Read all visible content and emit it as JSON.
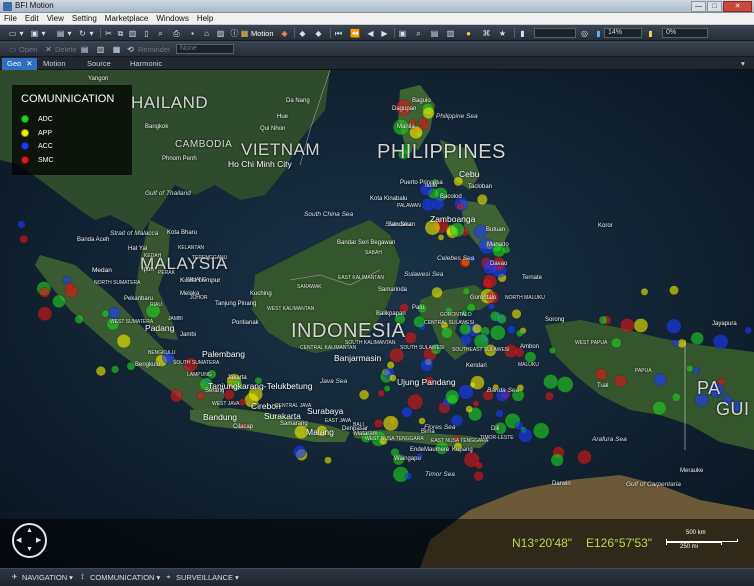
{
  "window": {
    "title": "BFI Motion",
    "controls": [
      "—",
      "□",
      "✕"
    ]
  },
  "menu": [
    "File",
    "Edit",
    "View",
    "Setting",
    "Marketplace",
    "Windows",
    "Help"
  ],
  "toolbar": {
    "motion_label": "Motion",
    "zoom_value": "14%",
    "progress_value": "0%"
  },
  "toolbar2": {
    "open_label": "Open",
    "delete_label": "Delete",
    "reminder_label": "Reminder",
    "reminder_value": "None"
  },
  "tabs": [
    {
      "label": "Geo",
      "active": true
    },
    {
      "label": "Motion",
      "active": false
    },
    {
      "label": "Source",
      "active": false
    },
    {
      "label": "Harmonic",
      "active": false
    }
  ],
  "legend": {
    "title": "COMUNNICATION",
    "items": [
      {
        "label": "ADC",
        "color": "#22d422"
      },
      {
        "label": "APP",
        "color": "#f5f000"
      },
      {
        "label": "ACC",
        "color": "#1a3cff"
      },
      {
        "label": "SMC",
        "color": "#e01818"
      }
    ]
  },
  "map_labels": {
    "countries": [
      "HAILAND",
      "CAMBODIA",
      "VIETNAM",
      "PHILIPPINES",
      "MALAYSIA",
      "INDONESIA",
      "PA",
      "GUI"
    ],
    "seas": [
      "South China Sea",
      "Sulu Sea",
      "Celebes Sea",
      "Sulawesi Sea",
      "Philippine Sea",
      "Java Sea",
      "Banda Sea",
      "Arafura Sea",
      "Timor Sea",
      "Gulf of Thailand",
      "Strait of Malacca",
      "Flores Sea",
      "Gulf of Carpentaria"
    ],
    "big_cities": [
      "Ho Chi Minh City",
      "Kuala Lumpur",
      "Palembang",
      "Tanjungkarang-Telukbetung",
      "Bandung",
      "Cirebon",
      "Surakarta",
      "Surabaya",
      "Malang",
      "Banjarmasin",
      "Ujung Pandang",
      "Cebu",
      "Zamboanga",
      "Medan",
      "Padang"
    ],
    "small_cities": [
      "Yangon",
      "Bangkok",
      "Phnom Penh",
      "Qui Nhon",
      "Manila",
      "Kuching",
      "Pontianak",
      "Samarinda",
      "Balikpapan",
      "Bengkulu",
      "Jakarta",
      "Serang",
      "Cilacap",
      "Bima",
      "Kupang",
      "Dili",
      "Kota Bharu",
      "Banda Aceh",
      "Davao",
      "Kendari",
      "Jayapura",
      "Darwin",
      "Kota Kinabalu",
      "Bandar Seri Begawan",
      "Koror",
      "Ambon",
      "Sorong",
      "Ternate",
      "Manado",
      "Tual",
      "Merauke",
      "Da Nang",
      "Hue",
      "Hat Yai",
      "Ipoh",
      "Melaka",
      "Tanjung Pinang",
      "Jambi",
      "Pekanbaru",
      "Samarang",
      "Mataram",
      "Denpasar",
      "Maumere",
      "Ende",
      "Waingapu",
      "Palu",
      "Gorontalo",
      "Sandakan",
      "Puerto Princesa",
      "Iloilo",
      "Bacolod",
      "Tacloban",
      "Butuan",
      "Baguio",
      "Dagupan"
    ],
    "regions": [
      "NORTH SUMATERA",
      "WEST SUMATERA",
      "SOUTH SUMATERA",
      "WEST KALIMANTAN",
      "CENTRAL KALIMANTAN",
      "EAST KALIMANTAN",
      "SOUTH KALIMANTAN",
      "SARAWAK",
      "SABAH",
      "PAPUA",
      "WEST PAPUA",
      "MALUKU",
      "NORTH MALUKU",
      "GORONTALO",
      "CENTRAL SULAWESI",
      "SOUTH SULAWESI",
      "SOUTHEAST SULAWESI",
      "EAST NUSA TENGGARA",
      "WEST NUSA TENGGARA",
      "WEST JAVA",
      "CENTRAL JAVA",
      "EAST JAVA",
      "BALI",
      "TIMOR-LESTE",
      "LAMPUNG",
      "BENGKULU",
      "JAMBI",
      "RIAU",
      "JOHOR",
      "PAHANG",
      "KEDAH",
      "PERAK",
      "KELANTAN",
      "TERENGGANU",
      "PALAWAN"
    ]
  },
  "coordinates": {
    "lat": "N13°20'48\"",
    "lon": "E126°57'53\""
  },
  "scale": {
    "km": "500 km",
    "mi": "250 mi"
  },
  "status": [
    {
      "label": "NAVIGATION"
    },
    {
      "label": "COMMUNICATION"
    },
    {
      "label": "SURVEILLANCE"
    }
  ]
}
